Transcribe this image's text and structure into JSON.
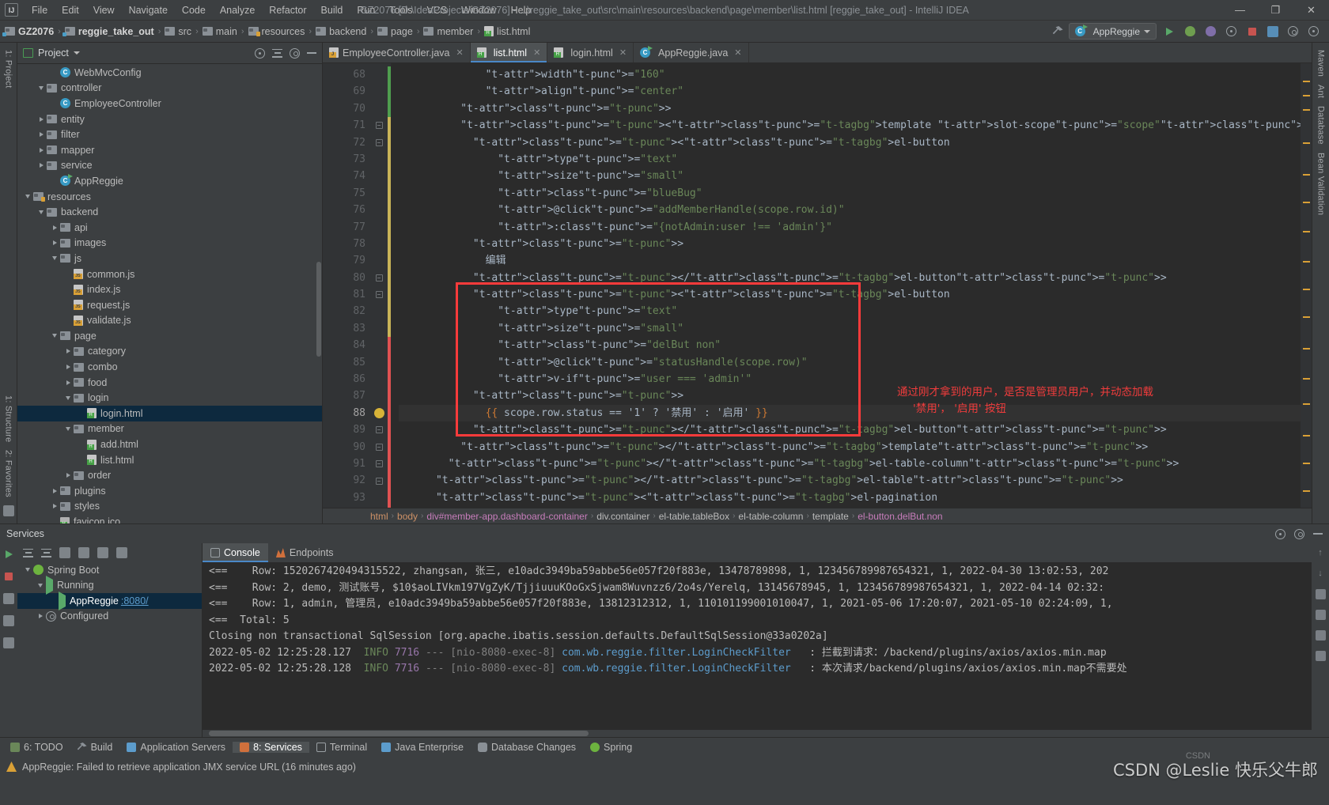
{
  "window": {
    "title": "GZ2076 [D:\\IdeaProjects\\GZ2076] - ...\\reggie_take_out\\src\\main\\resources\\backend\\page\\member\\list.html [reggie_take_out] - IntelliJ IDEA",
    "minimize": "—",
    "maximize": "❐",
    "close": "✕",
    "logo": "IJ"
  },
  "menu": [
    "File",
    "Edit",
    "View",
    "Navigate",
    "Code",
    "Analyze",
    "Refactor",
    "Build",
    "Run",
    "Tools",
    "VCS",
    "Window",
    "Help"
  ],
  "navbar": {
    "crumbs": [
      {
        "label": "GZ2076",
        "icon": "module-icon",
        "bold": true
      },
      {
        "label": "reggie_take_out",
        "icon": "module-icon",
        "bold": true
      },
      {
        "label": "src",
        "icon": "folder-icon",
        "bold": false
      },
      {
        "label": "main",
        "icon": "folder-icon",
        "bold": false
      },
      {
        "label": "resources",
        "icon": "resources-folder-icon",
        "bold": false
      },
      {
        "label": "backend",
        "icon": "folder-icon",
        "bold": false
      },
      {
        "label": "page",
        "icon": "folder-icon",
        "bold": false
      },
      {
        "label": "member",
        "icon": "folder-icon",
        "bold": false
      },
      {
        "label": "list.html",
        "icon": "html-file-icon",
        "bold": false
      }
    ],
    "run_config": "AppReggie",
    "separator": "›"
  },
  "project_panel": {
    "title": "Project",
    "tree": [
      {
        "label": "WebMvcConfig",
        "indent": 4,
        "icon": "class-icon",
        "twisty": "none",
        "selected": false
      },
      {
        "label": "controller",
        "indent": 3,
        "icon": "folder-icon",
        "twisty": "down",
        "selected": false
      },
      {
        "label": "EmployeeController",
        "indent": 4,
        "icon": "class-icon",
        "twisty": "none",
        "selected": false
      },
      {
        "label": "entity",
        "indent": 3,
        "icon": "folder-icon",
        "twisty": "right",
        "selected": false
      },
      {
        "label": "filter",
        "indent": 3,
        "icon": "folder-icon",
        "twisty": "right",
        "selected": false
      },
      {
        "label": "mapper",
        "indent": 3,
        "icon": "folder-icon",
        "twisty": "right",
        "selected": false
      },
      {
        "label": "service",
        "indent": 3,
        "icon": "folder-icon",
        "twisty": "right",
        "selected": false
      },
      {
        "label": "AppReggie",
        "indent": 4,
        "icon": "runnable-class-icon",
        "twisty": "none",
        "selected": false
      },
      {
        "label": "resources",
        "indent": 2,
        "icon": "resources-folder-icon",
        "twisty": "down",
        "selected": false
      },
      {
        "label": "backend",
        "indent": 3,
        "icon": "folder-icon",
        "twisty": "down",
        "selected": false
      },
      {
        "label": "api",
        "indent": 4,
        "icon": "folder-icon",
        "twisty": "right",
        "selected": false
      },
      {
        "label": "images",
        "indent": 4,
        "icon": "folder-icon",
        "twisty": "right",
        "selected": false
      },
      {
        "label": "js",
        "indent": 4,
        "icon": "folder-icon",
        "twisty": "down",
        "selected": false
      },
      {
        "label": "common.js",
        "indent": 5,
        "icon": "js-file-icon",
        "twisty": "none",
        "selected": false
      },
      {
        "label": "index.js",
        "indent": 5,
        "icon": "js-file-icon",
        "twisty": "none",
        "selected": false
      },
      {
        "label": "request.js",
        "indent": 5,
        "icon": "js-file-icon",
        "twisty": "none",
        "selected": false
      },
      {
        "label": "validate.js",
        "indent": 5,
        "icon": "js-file-icon",
        "twisty": "none",
        "selected": false
      },
      {
        "label": "page",
        "indent": 4,
        "icon": "folder-icon",
        "twisty": "down",
        "selected": false
      },
      {
        "label": "category",
        "indent": 5,
        "icon": "folder-icon",
        "twisty": "right",
        "selected": false
      },
      {
        "label": "combo",
        "indent": 5,
        "icon": "folder-icon",
        "twisty": "right",
        "selected": false
      },
      {
        "label": "food",
        "indent": 5,
        "icon": "folder-icon",
        "twisty": "right",
        "selected": false
      },
      {
        "label": "login",
        "indent": 5,
        "icon": "folder-icon",
        "twisty": "down",
        "selected": false
      },
      {
        "label": "login.html",
        "indent": 6,
        "icon": "html-file-icon",
        "twisty": "none",
        "selected": true
      },
      {
        "label": "member",
        "indent": 5,
        "icon": "folder-icon",
        "twisty": "down",
        "selected": false
      },
      {
        "label": "add.html",
        "indent": 6,
        "icon": "html-file-icon",
        "twisty": "none",
        "selected": false
      },
      {
        "label": "list.html",
        "indent": 6,
        "icon": "html-file-icon",
        "twisty": "none",
        "selected": false
      },
      {
        "label": "order",
        "indent": 5,
        "icon": "folder-icon",
        "twisty": "right",
        "selected": false
      },
      {
        "label": "plugins",
        "indent": 4,
        "icon": "folder-icon",
        "twisty": "right",
        "selected": false
      },
      {
        "label": "styles",
        "indent": 4,
        "icon": "folder-icon",
        "twisty": "right",
        "selected": false
      },
      {
        "label": "favicon.ico",
        "indent": 4,
        "icon": "file-icon",
        "twisty": "none",
        "selected": false
      }
    ]
  },
  "left_rail": {
    "top": "1: Project",
    "items": [
      "1: Structure",
      "2: Favorites"
    ]
  },
  "right_rail": {
    "items": [
      "Maven",
      "Ant",
      "Database",
      "Bean Validation"
    ]
  },
  "editor": {
    "tabs": [
      {
        "label": "EmployeeController.java",
        "icon": "java-file-icon",
        "active": false
      },
      {
        "label": "list.html",
        "icon": "html-file-icon",
        "active": true
      },
      {
        "label": "login.html",
        "icon": "html-file-icon",
        "active": false
      },
      {
        "label": "AppReggie.java",
        "icon": "java-file-icon",
        "active": false
      }
    ],
    "first_line": 68,
    "line_numbers": [
      68,
      69,
      70,
      71,
      72,
      73,
      74,
      75,
      76,
      77,
      78,
      79,
      80,
      81,
      82,
      83,
      84,
      85,
      86,
      87,
      88,
      89,
      90,
      91,
      92,
      93
    ],
    "highlighted_line": 88,
    "lines": [
      "              width=\"160\"",
      "              align=\"center\"",
      "          >",
      "          <template slot-scope=\"scope\">",
      "            <el-button",
      "                type=\"text\"",
      "                size=\"small\"",
      "                class=\"blueBug\"",
      "                @click=\"addMemberHandle(scope.row.id)\"",
      "                :class=\"{notAdmin:user !== 'admin'}\"",
      "            >",
      "              编辑",
      "            </el-button>",
      "            <el-button",
      "                type=\"text\"",
      "                size=\"small\"",
      "                class=\"delBut non\"",
      "                @click=\"statusHandle(scope.row)\"",
      "                v-if=\"user === 'admin'\"",
      "            >",
      "              {{ scope.row.status == '1' ? '禁用' : '启用' }}",
      "            </el-button>",
      "          </template>",
      "        </el-table-column>",
      "      </el-table>",
      "      <el-pagination"
    ],
    "annotation": {
      "line1": "通过刚才拿到的用户，是否是管理员用户，并动态加载",
      "line2": "'禁用'， '启用' 按钮",
      "color": "#f03c3c"
    },
    "breadcrumb": [
      {
        "label": "html",
        "color": "org"
      },
      {
        "label": "body",
        "color": "org"
      },
      {
        "label": "div#member-app.dashboard-container",
        "color": "pink"
      },
      {
        "label": "div.container",
        "color": "plain"
      },
      {
        "label": "el-table.tableBox",
        "color": "plain"
      },
      {
        "label": "el-table-column",
        "color": "plain"
      },
      {
        "label": "template",
        "color": "plain"
      },
      {
        "label": "el-button.delBut.non",
        "color": "pink"
      }
    ]
  },
  "services": {
    "title": "Services",
    "tree": [
      {
        "label": "Spring Boot",
        "indent": 1,
        "icon": "spring-icon",
        "twisty": "down",
        "selected": false,
        "port": ""
      },
      {
        "label": "Running",
        "indent": 2,
        "icon": "run-icon",
        "twisty": "down",
        "selected": false,
        "port": ""
      },
      {
        "label": "AppReggie",
        "indent": 3,
        "icon": "run-icon",
        "twisty": "none",
        "selected": true,
        "port": ":8080/"
      },
      {
        "label": "Configured",
        "indent": 2,
        "icon": "gear-icon",
        "twisty": "right",
        "selected": false,
        "port": ""
      }
    ],
    "console_tabs": [
      {
        "label": "Console",
        "icon": "console-icon",
        "active": true
      },
      {
        "label": "Endpoints",
        "icon": "endpoints-icon",
        "active": false
      }
    ],
    "console_lines": [
      {
        "arrow": "<==",
        "text": "    Row: 1520267420494315522, zhangsan, 张三, e10adc3949ba59abbe56e057f20f883e, 13478789898, 1, 123456789987654321, 1, 2022-04-30 13:02:53, 202"
      },
      {
        "arrow": "<==",
        "text": "    Row: 2, demo, 测试账号, $10$aoLIVkm197VgZyK/TjjiuuuKOoGxSjwam8Wuvnzz6/2o4s/Yerelq, 13145678945, 1, 123456789987654321, 1, 2022-04-14 02:32:"
      },
      {
        "arrow": "<==",
        "text": "    Row: 1, admin, 管理员, e10adc3949ba59abbe56e057f20f883e, 13812312312, 1, 110101199001010047, 1, 2021-05-06 17:20:07, 2021-05-10 02:24:09, 1,"
      },
      {
        "arrow": "<==",
        "text": "  Total: 5"
      }
    ],
    "closing_line": "Closing non transactional SqlSession [org.apache.ibatis.session.defaults.DefaultSqlSession@33a0202a]",
    "log_lines": [
      {
        "ts": "2022-05-02 12:25:28.127",
        "level": "INFO",
        "pid": "7716",
        "dash": "---",
        "thread": "[nio-8080-exec-8]",
        "logger": "com.wb.reggie.filter.LoginCheckFilter",
        "msg": ": 拦截到请求：/backend/plugins/axios/axios.min.map"
      },
      {
        "ts": "2022-05-02 12:25:28.128",
        "level": "INFO",
        "pid": "7716",
        "dash": "---",
        "thread": "[nio-8080-exec-8]",
        "logger": "com.wb.reggie.filter.LoginCheckFilter",
        "msg": ": 本次请求/backend/plugins/axios/axios.min.map不需要处"
      }
    ]
  },
  "statusbar": {
    "items": [
      {
        "label": "6: TODO",
        "icon": "todo-icon",
        "active": false
      },
      {
        "label": "Build",
        "icon": "build-icon",
        "active": false
      },
      {
        "label": "Application Servers",
        "icon": "server-icon",
        "active": false
      },
      {
        "label": "8: Services",
        "icon": "services-icon",
        "active": true
      },
      {
        "label": "Terminal",
        "icon": "terminal-icon",
        "active": false
      },
      {
        "label": "Java Enterprise",
        "icon": "java-enterprise-icon",
        "active": false
      },
      {
        "label": "Database Changes",
        "icon": "database-icon",
        "active": false
      },
      {
        "label": "Spring",
        "icon": "spring-icon",
        "active": false
      }
    ],
    "footer_message": "AppReggie: Failed to retrieve application JMX service URL (16 minutes ago)"
  },
  "watermark": {
    "text": "CSDN @Leslie 快乐父牛郎",
    "small": "CSDN"
  }
}
